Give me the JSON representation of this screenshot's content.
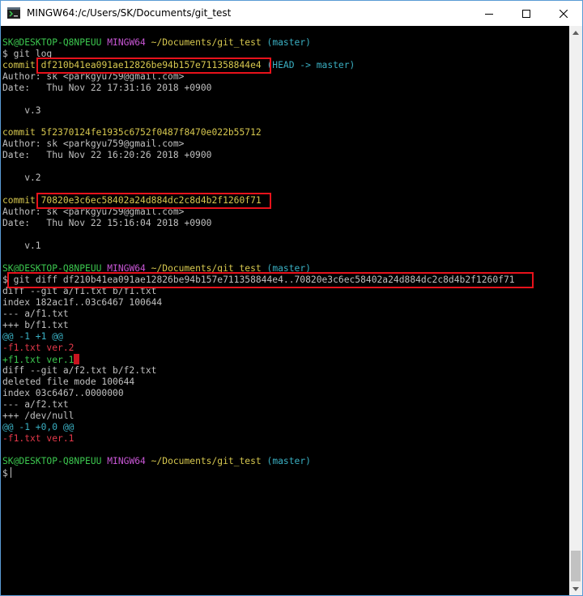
{
  "window": {
    "title": "MINGW64:/c/Users/SK/Documents/git_test",
    "icons": {
      "app": "mingw-app-icon",
      "minimize": "minimize-icon",
      "maximize": "maximize-icon",
      "close": "close-icon"
    },
    "colors": {
      "background": "#000000",
      "green": "#3cc84f",
      "magenta": "#c957d6",
      "yellow": "#d7c84f",
      "cyan": "#3ab0c3",
      "red": "#e5394a",
      "text": "#c0c0c0",
      "highlight_box": "#e8121b"
    }
  },
  "terminal": {
    "prompt1": {
      "user": "SK@DESKTOP-Q8NPEUU",
      "env": "MINGW64",
      "path": "~/Documents/git_test",
      "branch": "(master)"
    },
    "cmd1": "$ git log",
    "commit1": {
      "label": "commit",
      "hash": "df210b41ea091ae12826be94b157e711358844e4",
      "ref": "(HEAD -> master)",
      "author": "Author: sk <parkgyu759@gmail.com>",
      "date": "Date:   Thu Nov 22 17:31:16 2018 +0900",
      "message": "    v.3"
    },
    "commit2": {
      "label": "commit",
      "hash": "5f2370124fe1935c6752f0487f8470e022b55712",
      "author": "Author: sk <parkgyu759@gmail.com>",
      "date": "Date:   Thu Nov 22 16:20:26 2018 +0900",
      "message": "    v.2"
    },
    "commit3": {
      "label": "commit",
      "hash": "70820e3c6ec58402a24d884dc2c8d4b2f1260f71",
      "author": "Author: sk <parkgyu759@gmail.com>",
      "date": "Date:   Thu Nov 22 15:16:04 2018 +0900",
      "message": "    v.1"
    },
    "prompt2": {
      "user": "SK@DESKTOP-Q8NPEUU",
      "env": "MINGW64",
      "path": "~/Documents/git_test",
      "branch": "(master)"
    },
    "cmd2": {
      "dollar": "$",
      "command": "git diff df210b41ea091ae12826be94b157e711358844e4..70820e3c6ec58402a24d884dc2c8d4b2f1260f71"
    },
    "diff": [
      {
        "text": "diff --git a/f1.txt b/f1.txt",
        "color": "w"
      },
      {
        "text": "index 182ac1f..03c6467 100644",
        "color": "w"
      },
      {
        "text": "--- a/f1.txt",
        "color": "w"
      },
      {
        "text": "+++ b/f1.txt",
        "color": "w"
      },
      {
        "text": "@@ -1 +1 @@",
        "color": "c"
      },
      {
        "text": "-f1.txt ver.2",
        "color": "r"
      },
      {
        "text": "+f1.txt ver.1",
        "color": "g"
      },
      {
        "text": "diff --git a/f2.txt b/f2.txt",
        "color": "w"
      },
      {
        "text": "deleted file mode 100644",
        "color": "w"
      },
      {
        "text": "index 03c6467..0000000",
        "color": "w"
      },
      {
        "text": "--- a/f2.txt",
        "color": "w"
      },
      {
        "text": "+++ /dev/null",
        "color": "w"
      },
      {
        "text": "@@ -1 +0,0 @@",
        "color": "c"
      },
      {
        "text": "-f1.txt ver.1",
        "color": "r"
      }
    ],
    "prompt3": {
      "user": "SK@DESKTOP-Q8NPEUU",
      "env": "MINGW64",
      "path": "~/Documents/git_test",
      "branch": "(master)"
    },
    "cmd3": "$"
  }
}
